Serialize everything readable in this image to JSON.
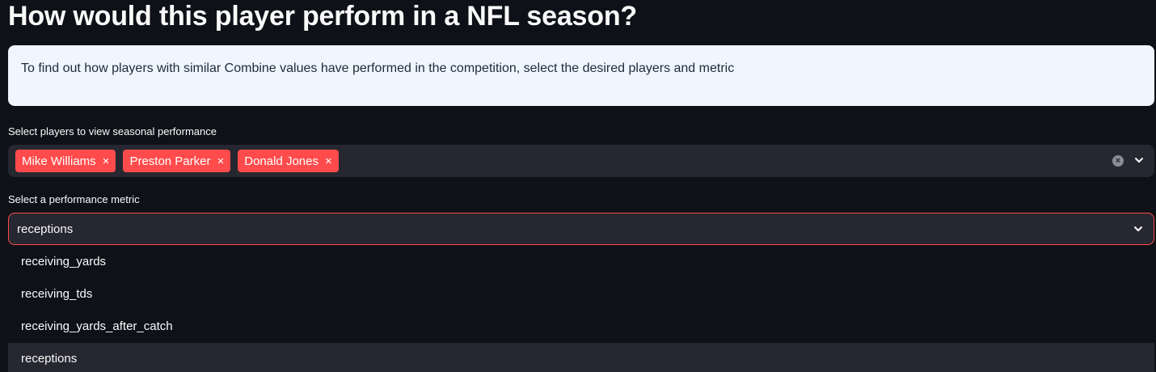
{
  "page": {
    "title": "How would this player perform in a NFL season?"
  },
  "info": {
    "text": "To find out how players with similar Combine values have performed in the competition, select the desired players and metric",
    "background": "#eff6ff"
  },
  "players_select": {
    "label": "Select players to view seasonal performance",
    "tags": [
      "Mike Williams",
      "Preston Parker",
      "Donald Jones"
    ],
    "tag_color": "#ff4b4b",
    "remove_glyph": "×",
    "clear_glyph": "×"
  },
  "metric_select": {
    "label": "Select a performance metric",
    "value": "receptions",
    "options": [
      "receiving_yards",
      "receiving_tds",
      "receiving_yards_after_catch",
      "receptions"
    ],
    "selected_index": 3,
    "border_color": "#ff4b4b"
  },
  "icons": {
    "clear": "clear-circle-icon",
    "chevron": "chevron-down-icon",
    "remove": "close-icon"
  }
}
